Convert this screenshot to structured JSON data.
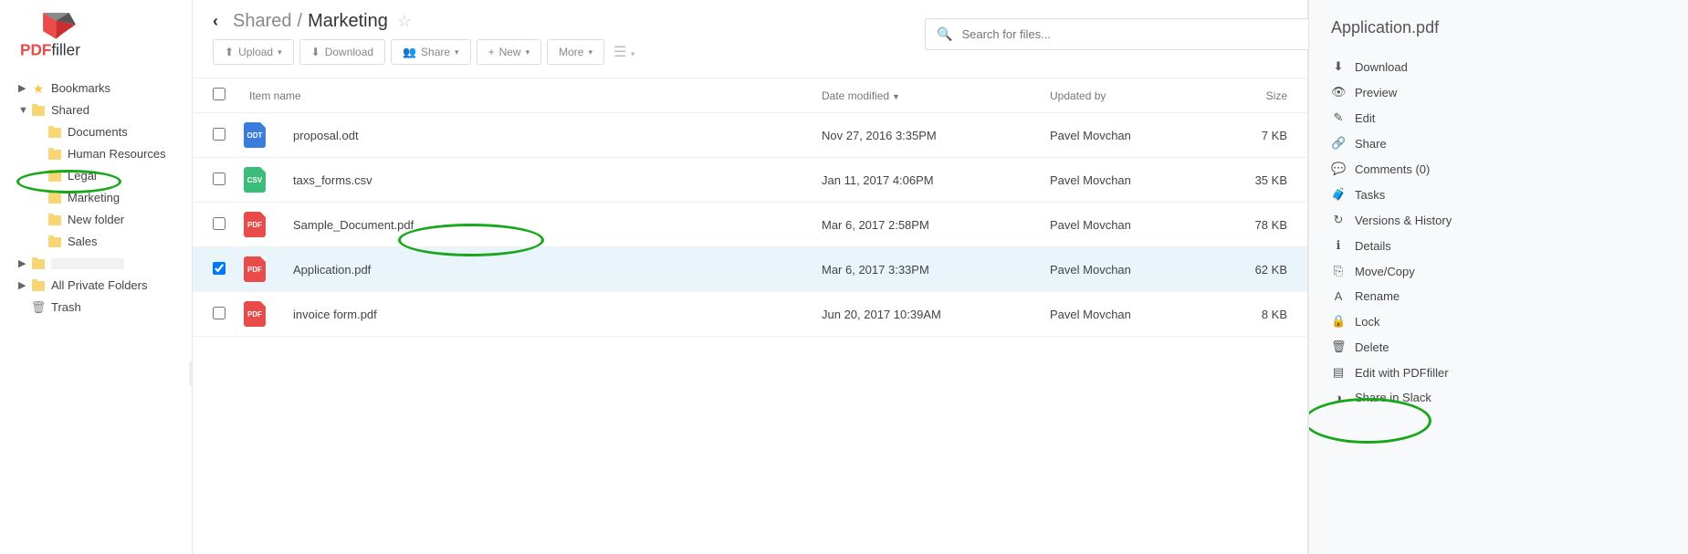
{
  "brand": {
    "name1": "PDF",
    "name2": "filler"
  },
  "sidebar": {
    "bookmarks": "Bookmarks",
    "shared": "Shared",
    "children": [
      "Documents",
      "Human Resources",
      "Legal",
      "Marketing",
      "New folder",
      "Sales"
    ],
    "blank_entry": "",
    "all_private": "All Private Folders",
    "trash": "Trash"
  },
  "breadcrumb": {
    "root": "Shared",
    "sep": "/",
    "current": "Marketing"
  },
  "toolbar": {
    "upload": "Upload",
    "download": "Download",
    "share": "Share",
    "new": "New",
    "more": "More"
  },
  "search": {
    "placeholder": "Search for files..."
  },
  "columns": {
    "name": "Item name",
    "date": "Date modified",
    "user": "Updated by",
    "size": "Size"
  },
  "rows": [
    {
      "type": "odt",
      "name": "proposal.odt",
      "date": "Nov 27, 2016 3:35PM",
      "user": "Pavel Movchan",
      "size": "7 KB",
      "checked": false
    },
    {
      "type": "csv",
      "name": "taxs_forms.csv",
      "date": "Jan 11, 2017 4:06PM",
      "user": "Pavel Movchan",
      "size": "35 KB",
      "checked": false
    },
    {
      "type": "pdf",
      "name": "Sample_Document.pdf",
      "date": "Mar 6, 2017 2:58PM",
      "user": "Pavel Movchan",
      "size": "78 KB",
      "checked": false
    },
    {
      "type": "pdf",
      "name": "Application.pdf",
      "date": "Mar 6, 2017 3:33PM",
      "user": "Pavel Movchan",
      "size": "62 KB",
      "checked": true
    },
    {
      "type": "pdf",
      "name": "invoice form.pdf",
      "date": "Jun 20, 2017 10:39AM",
      "user": "Pavel Movchan",
      "size": "8 KB",
      "checked": false
    }
  ],
  "panel": {
    "title": "Application.pdf",
    "actions": [
      {
        "icon": "⬇",
        "label": "Download"
      },
      {
        "icon": "👁",
        "label": "Preview"
      },
      {
        "icon": "✎",
        "label": "Edit"
      },
      {
        "icon": "🔗",
        "label": "Share"
      },
      {
        "icon": "💬",
        "label": "Comments (0)"
      },
      {
        "icon": "🧳",
        "label": "Tasks"
      },
      {
        "icon": "↻",
        "label": "Versions & History"
      },
      {
        "icon": "ℹ",
        "label": "Details"
      },
      {
        "icon": "⎘",
        "label": "Move/Copy"
      },
      {
        "icon": "A",
        "label": "Rename"
      },
      {
        "icon": "🔒",
        "label": "Lock"
      },
      {
        "icon": "🗑",
        "label": "Delete"
      },
      {
        "icon": "▤",
        "label": "Edit with PDFfiller"
      },
      {
        "icon": "◑",
        "label": "Share in Slack"
      }
    ]
  },
  "highlights": {
    "marketing_folder": true,
    "application_row": true,
    "edit_pdffiller": true
  }
}
